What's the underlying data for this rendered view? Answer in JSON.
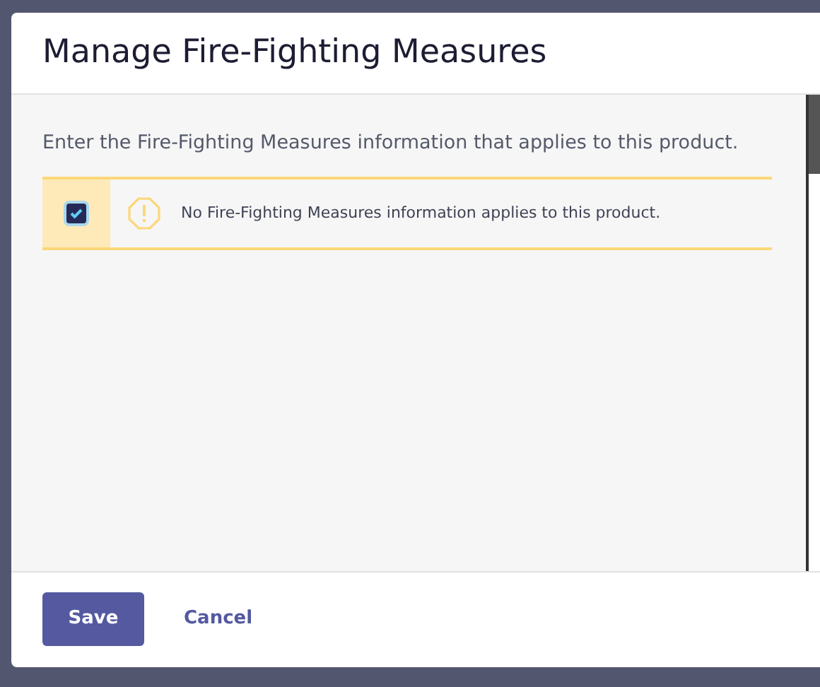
{
  "dialog": {
    "title": "Manage Fire-Fighting Measures",
    "instructions": "Enter the Fire-Fighting Measures information that applies to this product.",
    "option": {
      "checked": true,
      "label": "No Fire-Fighting Measures information applies to this product."
    },
    "buttons": [
      {
        "kind": "primary",
        "label": "Save"
      },
      {
        "kind": "link",
        "label": "Cancel"
      }
    ]
  }
}
